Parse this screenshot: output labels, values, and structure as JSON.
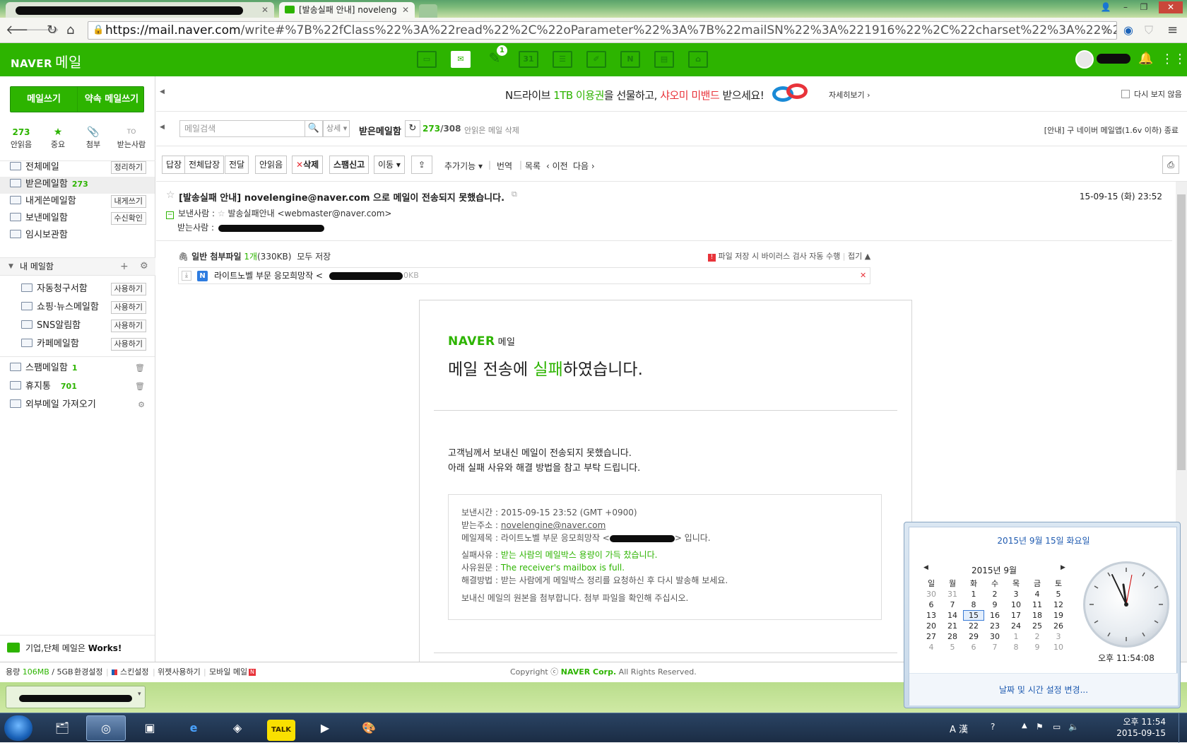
{
  "browser": {
    "tab2_title": "[발송실패 안내] noveleng",
    "url_host": "https://mail.naver.com",
    "url_rest": "/write#%7B%22fClass%22%3A%22read%22%2C%22oParameter%22%3A%7B%22mailSN%22%3A%221916%22%2C%22charset%22%3A%22%22%2C%22prevNextMail%22%"
  },
  "header": {
    "logo": "NAVER",
    "logo_sub": "메일",
    "badge": "1"
  },
  "sidebar": {
    "write": "메일쓰기",
    "write_self": "약속 메일쓰기",
    "quick": [
      {
        "label": "안읽음",
        "value": "273"
      },
      {
        "label": "중요",
        "value": "★"
      },
      {
        "label": "첨부",
        "value": "📎"
      },
      {
        "label": "받는사람",
        "value": "TO"
      }
    ],
    "folders": [
      {
        "label": "전체메일",
        "button": "정리하기"
      },
      {
        "label": "받은메일함",
        "count": "273"
      },
      {
        "label": "내게쓴메일함",
        "button": "내게쓰기"
      },
      {
        "label": "보낸메일함",
        "button": "수신확인"
      },
      {
        "label": "임시보관함"
      }
    ],
    "my_folders_title": "내 메일함",
    "my_folders": [
      {
        "label": "자동청구서함",
        "button": "사용하기"
      },
      {
        "label": "쇼핑·뉴스메일함",
        "button": "사용하기"
      },
      {
        "label": "SNS알림함",
        "button": "사용하기"
      },
      {
        "label": "카페메일함",
        "button": "사용하기"
      }
    ],
    "etc_folders": [
      {
        "label": "스팸메일함",
        "count": "1"
      },
      {
        "label": "휴지통",
        "count": "701"
      },
      {
        "label": "외부메일 가져오기"
      }
    ],
    "works_text": "기업,단체 메일은",
    "works_brand": "Works!"
  },
  "banner": {
    "t1": "N드라이브 ",
    "t2": "1TB 이용권",
    "t3": "을 선물하고, ",
    "t4": "샤오미 미밴드",
    "t5": " 받으세요!",
    "more": "자세히보기 ›",
    "hide": "다시 보지 않음"
  },
  "search": {
    "placeholder": "메일검색",
    "detail": "상세",
    "folder": "받은메일함",
    "unread": "273",
    "total": "/308",
    "delete_read": "안읽은 메일 삭제",
    "notice": "[안내] 구 네이버 메일앱(1.6v 이하) 종료"
  },
  "toolbar": {
    "reply": "답장",
    "reply_all": "전체답장",
    "forward": "전달",
    "unread": "안읽음",
    "delete": "삭제",
    "spam": "스팸신고",
    "move": "이동",
    "more": "추가기능",
    "translate": "번역",
    "list": "목록",
    "prev": "‹ 이전",
    "next": "다음 ›"
  },
  "mail": {
    "subject": "[발송실패 안내] novelengine@naver.com 으로 메일이 전송되지 못했습니다.",
    "date": "15-09-15 (화) 23:52",
    "from_label": "보낸사람 :",
    "from": "발송실패안내 <webmaster@naver.com>",
    "to_label": "받는사람 :",
    "attach_title": "일반 첨부파일",
    "attach_count": "1개",
    "attach_size": "(330KB)",
    "attach_save_all": "모두 저장",
    "attach_virus": "파일 저장 시 바이러스 검사 자동 수행",
    "attach_fold": "접기 ▲",
    "attach_name": "라이트노벨 부문 응모희망작 <",
    "attach_filesize": "0KB"
  },
  "body": {
    "logo": "NAVER",
    "logo_sub": "메일",
    "title_a": "메일 전송에 ",
    "title_b": "실패",
    "title_c": "하였습니다.",
    "msg1": "고객님께서 보내신 메일이 전송되지 못했습니다.",
    "msg2": "아래 실패 사유와 해결 방법을 참고 부탁 드립니다.",
    "sent_time": "보낸시간 : 2015-09-15 23:52 (GMT +0900)",
    "to_addr_label": "받는주소 : ",
    "to_addr": "novelengine@naver.com",
    "subject_label": "메일제목 : 라이트노벨 부문 응모희망작 <",
    "subject_tail": "> 입니다.",
    "reason_label": "실패사유 : ",
    "reason": "받는 사람의 메일박스 용량이 가득 찼습니다.",
    "orig_label": "사유원문 : ",
    "orig": "The receiver's mailbox is full.",
    "solution": "해결방법 : 받는 사람에게 메일박스 정리를 요청하신 후 다시 발송해 보세요.",
    "attached_note": "보내신 메일의 원본을 첨부합니다. 첨부 파일을 확인해 주십시오."
  },
  "footer": {
    "storage_label": "용량 ",
    "storage": "106MB",
    "storage_total": " / 5GB",
    "settings": "환경설정",
    "skin": "스킨설정",
    "widget": "위젯사용하기",
    "mobile": "모바일 메일",
    "copyright_a": "Copyright ⓒ ",
    "copyright_b": "NAVER Corp.",
    "copyright_c": " All Rights Reserved."
  },
  "calendar": {
    "header": "2015년 9월 15일 화요일",
    "month": "2015년 9월",
    "weekdays": [
      "일",
      "월",
      "화",
      "수",
      "목",
      "금",
      "토"
    ],
    "weeks": [
      [
        "30",
        "31",
        "1",
        "2",
        "3",
        "4",
        "5"
      ],
      [
        "6",
        "7",
        "8",
        "9",
        "10",
        "11",
        "12"
      ],
      [
        "13",
        "14",
        "15",
        "16",
        "17",
        "18",
        "19"
      ],
      [
        "20",
        "21",
        "22",
        "23",
        "24",
        "25",
        "26"
      ],
      [
        "27",
        "28",
        "29",
        "30",
        "1",
        "2",
        "3"
      ],
      [
        "4",
        "5",
        "6",
        "7",
        "8",
        "9",
        "10"
      ]
    ],
    "time": "오후 11:54:08",
    "change": "날짜 및 시간 설정 변경..."
  },
  "taskbar": {
    "time": "오후 11:54",
    "date": "2015-09-15",
    "ime": "A 漢",
    "talk": "TALK"
  }
}
